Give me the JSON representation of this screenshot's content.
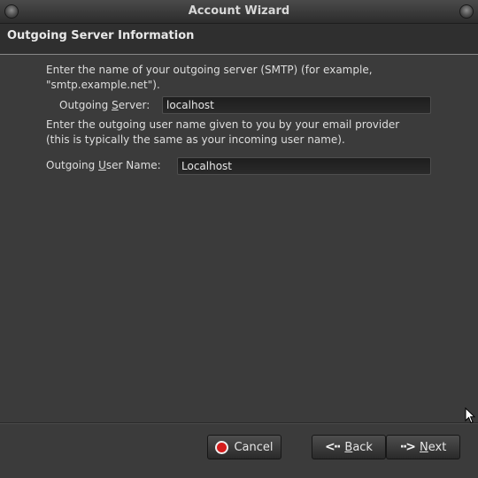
{
  "window": {
    "title": "Account Wizard"
  },
  "page": {
    "heading": "Outgoing Server Information"
  },
  "server": {
    "description_line1": "Enter the name of your outgoing server (SMTP) (for example,",
    "description_line2": "\"smtp.example.net\").",
    "label_pre": "Outgoing ",
    "label_mnemonic": "S",
    "label_post": "erver:",
    "value": "localhost"
  },
  "username": {
    "description_line1": "Enter the outgoing user name given to you by your email provider",
    "description_line2": "(this is typically the same as your incoming user name).",
    "label_pre": "Outgoing ",
    "label_mnemonic": "U",
    "label_post": "ser Name:",
    "value": "Localhost"
  },
  "buttons": {
    "cancel": "Cancel",
    "back_mnemonic": "B",
    "back_rest": "ack",
    "next_mnemonic": "N",
    "next_rest": "ext"
  },
  "icons": {
    "cancel": "stop-icon",
    "back": "back-arrow-icon",
    "next": "next-arrow-icon",
    "cursor": "mouse-pointer-icon"
  },
  "colors": {
    "background": "#3b3b3b",
    "field_background": "#1e1e1e",
    "stop_red": "#d41c1c"
  }
}
